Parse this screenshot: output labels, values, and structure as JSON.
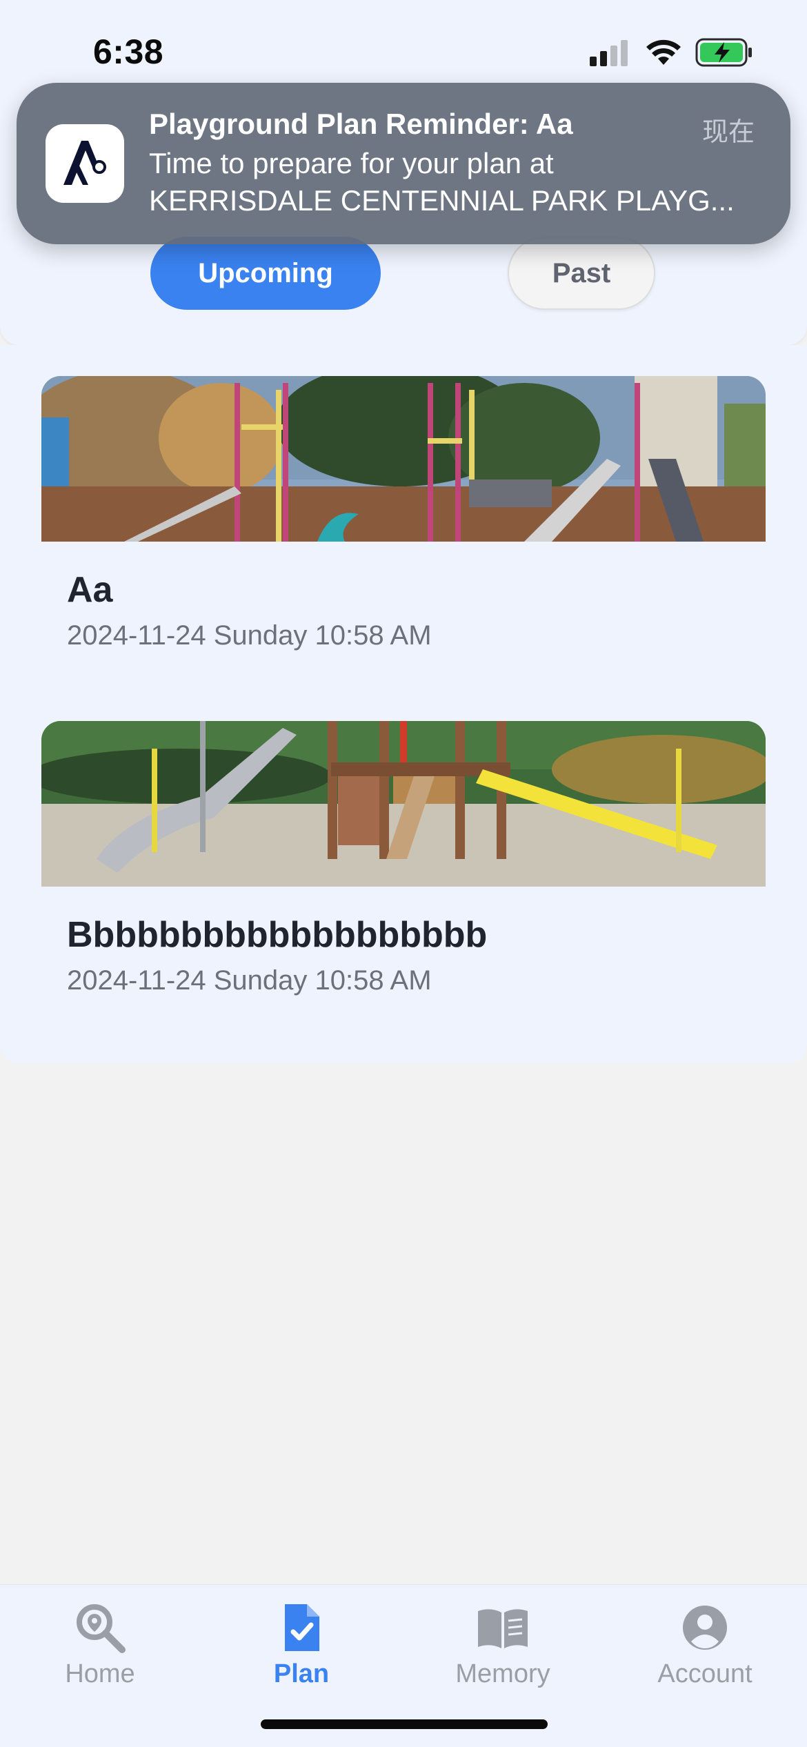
{
  "status_bar": {
    "time": "6:38"
  },
  "notification": {
    "title": "Playground Plan Reminder: Aa",
    "time": "现在",
    "body_line1": "Time to prepare for your plan at",
    "body_line2": "KERRISDALE CENTENNIAL PARK PLAYG..."
  },
  "filter_tabs": {
    "upcoming": "Upcoming",
    "past": "Past",
    "selected": "Upcoming"
  },
  "plans": [
    {
      "title": "Aa",
      "date": "2024-11-24 Sunday 10:58 AM"
    },
    {
      "title": "Bbbbbbbbbbbbbbbbbbb",
      "date": "2024-11-24 Sunday 10:58 AM"
    }
  ],
  "tab_bar": {
    "items": [
      {
        "label": "Home",
        "icon": "search-location-icon"
      },
      {
        "label": "Plan",
        "icon": "checklist-document-icon"
      },
      {
        "label": "Memory",
        "icon": "open-book-icon"
      },
      {
        "label": "Account",
        "icon": "user-circle-icon"
      }
    ],
    "active": "Plan"
  },
  "colors": {
    "accent": "#3a82f0",
    "background": "#eef3fd",
    "inactive": "#9a9ea6"
  }
}
